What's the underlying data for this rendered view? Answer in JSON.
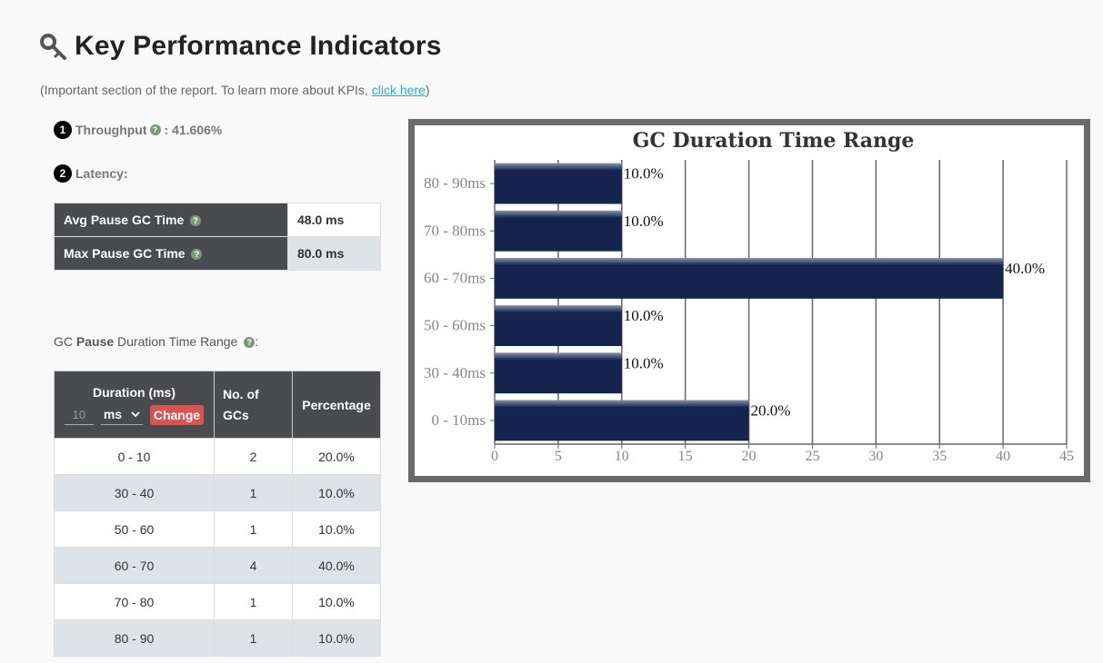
{
  "header": {
    "title": "Key Performance Indicators",
    "subtitle_prefix": "(Important section of the report. To learn more about KPIs, ",
    "subtitle_link": "click here",
    "subtitle_suffix": ")"
  },
  "kpi": {
    "throughput_num": "1",
    "throughput_label": "Throughput",
    "throughput_value": ": 41.606%",
    "latency_num": "2",
    "latency_label": "Latency:"
  },
  "latency": {
    "rows": [
      {
        "label": "Avg Pause GC Time",
        "value": "48.0 ms"
      },
      {
        "label": "Max Pause GC Time",
        "value": "80.0 ms"
      }
    ]
  },
  "range_section": {
    "prefix": "GC ",
    "bold": "Pause",
    "suffix": " Duration Time Range",
    "tail": ":"
  },
  "duration_table": {
    "headers": {
      "duration": "Duration (ms)",
      "gcs_line1": "No. of",
      "gcs_line2": "GCs",
      "percentage": "Percentage"
    },
    "input_value": "10",
    "unit_selected": "ms",
    "change_label": "Change",
    "rows": [
      {
        "range": "0 - 10",
        "count": "2",
        "pct": "20.0%"
      },
      {
        "range": "30 - 40",
        "count": "1",
        "pct": "10.0%"
      },
      {
        "range": "50 - 60",
        "count": "1",
        "pct": "10.0%"
      },
      {
        "range": "60 - 70",
        "count": "4",
        "pct": "40.0%"
      },
      {
        "range": "70 - 80",
        "count": "1",
        "pct": "10.0%"
      },
      {
        "range": "80 - 90",
        "count": "1",
        "pct": "10.0%"
      }
    ]
  },
  "chart_data": {
    "type": "bar",
    "orientation": "horizontal",
    "title": "GC Duration Time Range",
    "categories": [
      "80 - 90ms",
      "70 - 80ms",
      "60 - 70ms",
      "50 - 60ms",
      "30 - 40ms",
      "0 - 10ms"
    ],
    "values": [
      10,
      10,
      40,
      10,
      10,
      20
    ],
    "value_labels": [
      "10.0%",
      "10.0%",
      "40.0%",
      "10.0%",
      "10.0%",
      "20.0%"
    ],
    "xlim": [
      0,
      45
    ],
    "xticks": [
      0,
      5,
      10,
      15,
      20,
      25,
      30,
      35,
      40,
      45
    ],
    "grid": true,
    "bar_color": "#15234f"
  }
}
